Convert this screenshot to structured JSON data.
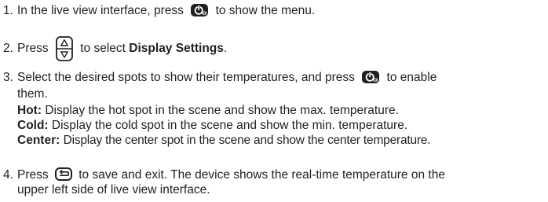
{
  "steps": [
    {
      "number": "1.",
      "text_before": "In the live view interface, press",
      "icon": "power-menu-icon",
      "text_after": "to show the menu."
    },
    {
      "number": "2.",
      "text_before": "Press",
      "icon": "up-down-navigation-icon",
      "text_middle": "to select",
      "bold_term": "Display Settings",
      "text_end": "."
    },
    {
      "number": "3.",
      "text_before": "Select the desired spots to show their temperatures, and press",
      "icon": "power-menu-icon",
      "text_after": "to enable",
      "text_cont": "them.",
      "details": [
        {
          "term": "Hot:",
          "description": "Display the hot spot in the scene and show the max. temperature."
        },
        {
          "term": "Cold:",
          "description": "Display the cold spot in the scene and show the min. temperature."
        },
        {
          "term": "Center:",
          "description": "Display the center spot in the scene and show the center temperature."
        }
      ]
    },
    {
      "number": "4.",
      "text_before": "Press",
      "icon": "back-icon",
      "text_after": "to save and exit. The device shows the real-time temperature on the",
      "text_cont": "upper left side of live view interface."
    }
  ],
  "colors": {
    "text": "#231f20",
    "icon": "#231f20"
  }
}
